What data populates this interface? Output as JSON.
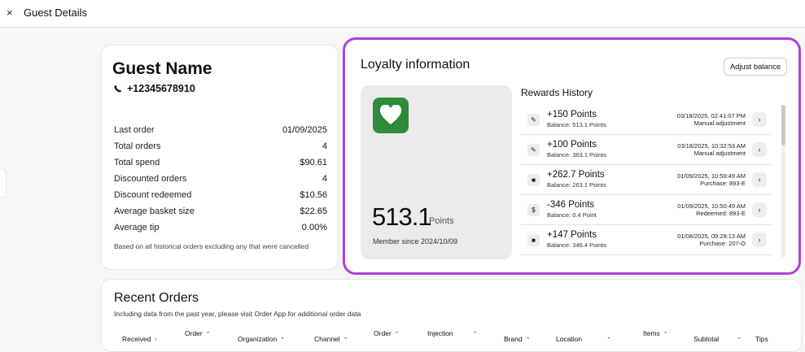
{
  "header": {
    "title": "Guest Details",
    "close_glyph": "×"
  },
  "guest": {
    "name": "Guest Name",
    "phone": "+12345678910",
    "stats": [
      {
        "label": "Last order",
        "value": "01/09/2025"
      },
      {
        "label": "Total orders",
        "value": "4"
      },
      {
        "label": "Total spend",
        "value": "$90.61"
      },
      {
        "label": "Discounted orders",
        "value": "4"
      },
      {
        "label": "Discount redeemed",
        "value": "$10.56"
      },
      {
        "label": "Average basket size",
        "value": "$22.65"
      },
      {
        "label": "Average tip",
        "value": "0.00%"
      }
    ],
    "note": "Based on all historical orders excluding any that were cancelled"
  },
  "loyalty": {
    "title": "Loyalty information",
    "adjust_label": "Adjust balance",
    "balance": "513.1",
    "points_unit": "Points",
    "member_since": "Member since 2024/10/09",
    "accent": "#b040d8",
    "brand_color": "#2f8a3a",
    "rewards_title": "Rewards History",
    "rewards": [
      {
        "icon": "pencil-icon",
        "glyph": "✎",
        "points": "+150 Points",
        "balance": "Balance: 513.1 Points",
        "date": "03/18/2025, 02:41:07 PM",
        "desc": "Manual adjustment"
      },
      {
        "icon": "pencil-icon",
        "glyph": "✎",
        "points": "+100 Points",
        "balance": "Balance: 363.1 Points",
        "date": "03/18/2025, 10:32:53 AM",
        "desc": "Manual adjustment"
      },
      {
        "icon": "bag-icon",
        "glyph": "■",
        "points": "+262.7 Points",
        "balance": "Balance: 263.1 Points",
        "date": "01/09/2025, 10:50:49 AM",
        "desc": "Purchase: 893-E"
      },
      {
        "icon": "coin-icon",
        "glyph": "$",
        "points": "-346 Points",
        "balance": "Balance: 0.4 Point",
        "date": "01/09/2025, 10:50:49 AM",
        "desc": "Redeemed: 893-E"
      },
      {
        "icon": "bag-icon",
        "glyph": "■",
        "points": "+147 Points",
        "balance": "Balance: 346.4 Points",
        "date": "01/08/2025, 09:28:13 AM",
        "desc": "Purchase: 207-O"
      }
    ]
  },
  "orders": {
    "title": "Recent Orders",
    "subtitle": "Including data from the past year, please visit Order App for additional order data",
    "columns": [
      "Received",
      "Order",
      "Organization",
      "Channel",
      "Order",
      "Injection",
      "Brand",
      "Location",
      "Items",
      "Subtotal",
      "Tips"
    ],
    "sort_up": "↑",
    "sort_glyph": "⌃"
  }
}
